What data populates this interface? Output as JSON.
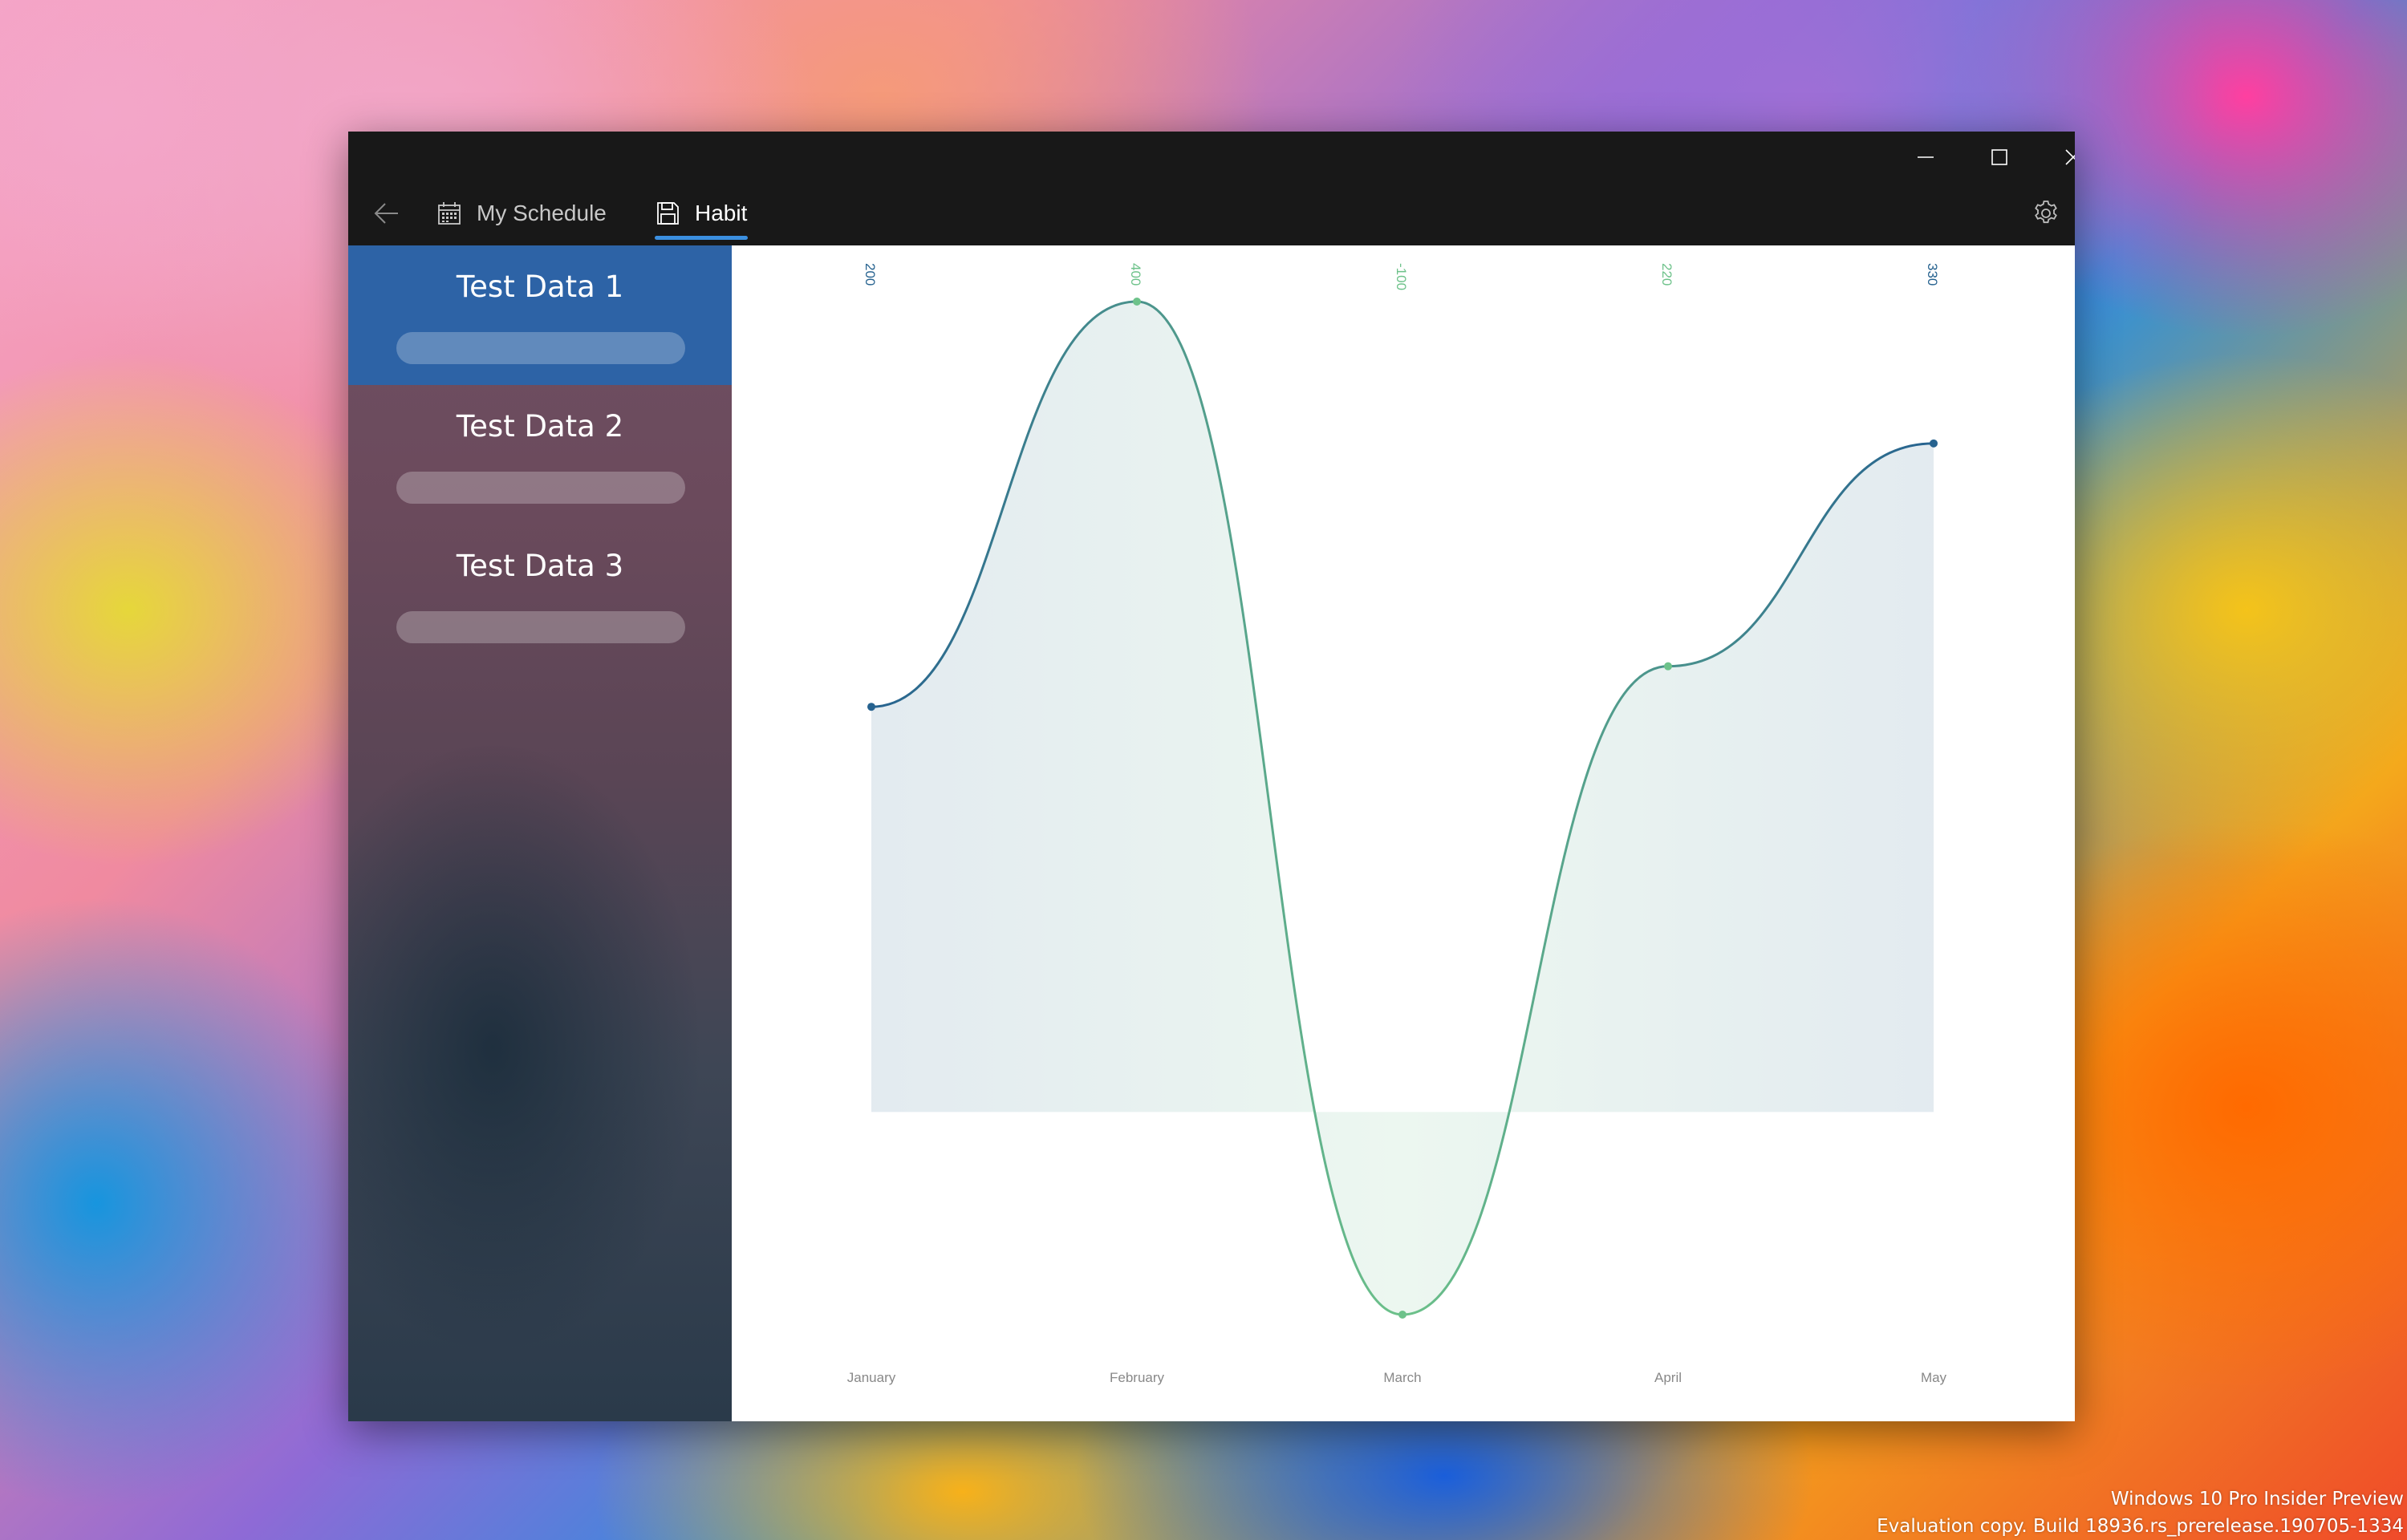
{
  "nav": {
    "tabs": [
      {
        "label": "My Schedule",
        "icon": "calendar-icon"
      },
      {
        "label": "Habit",
        "icon": "save-icon"
      }
    ]
  },
  "sidebar": {
    "items": [
      {
        "label": "Test Data 1",
        "selected": true
      },
      {
        "label": "Test Data 2",
        "selected": false
      },
      {
        "label": "Test Data 3",
        "selected": false
      }
    ]
  },
  "colors": {
    "accent": "#3b8fe0",
    "selected_item": "#2d63a6",
    "series_blue": "#26628f",
    "series_green": "#6dc28a"
  },
  "chart_data": {
    "type": "area",
    "categories": [
      "January",
      "February",
      "March",
      "April",
      "May"
    ],
    "values": [
      200,
      400,
      -100,
      220,
      330
    ],
    "value_labels": [
      "200",
      "400",
      "-100",
      "220",
      "330"
    ],
    "ylim": [
      -100,
      400
    ],
    "baseline": 0,
    "grid": false
  },
  "watermark": {
    "line1": "Windows 10 Pro Insider Preview",
    "line2": "Evaluation copy. Build 18936.rs_prerelease.190705-1334"
  }
}
